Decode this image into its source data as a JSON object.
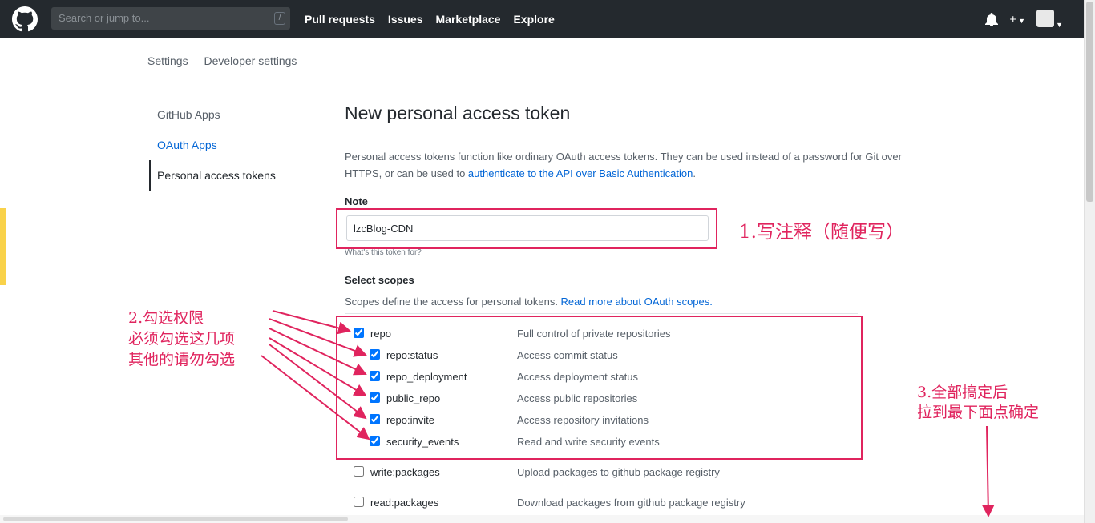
{
  "header": {
    "search_placeholder": "Search or jump to...",
    "search_shortcut": "/",
    "nav": [
      "Pull requests",
      "Issues",
      "Marketplace",
      "Explore"
    ],
    "plus_label": "+"
  },
  "breadcrumb": [
    "Settings",
    "Developer settings"
  ],
  "sidebar": {
    "items": [
      {
        "label": "GitHub Apps"
      },
      {
        "label": "OAuth Apps"
      },
      {
        "label": "Personal access tokens"
      }
    ]
  },
  "main": {
    "title": "New personal access token",
    "desc_line1": "Personal access tokens function like ordinary OAuth access tokens. They can be used instead of a password for Git over",
    "desc_line2_pre": "HTTPS, or can be used to ",
    "desc_link": "authenticate to the API over Basic Authentication",
    "desc_line2_post": ".",
    "note_label": "Note",
    "note_value": "lzcBlog-CDN",
    "note_help": "What's this token for?",
    "scopes_label": "Select scopes",
    "scopes_desc": "Scopes define the access for personal tokens. ",
    "scopes_link": "Read more about OAuth scopes."
  },
  "scopes": [
    {
      "name": "repo",
      "desc": "Full control of private repositories",
      "checked": true
    },
    {
      "name": "repo:status",
      "desc": "Access commit status",
      "checked": true
    },
    {
      "name": "repo_deployment",
      "desc": "Access deployment status",
      "checked": true
    },
    {
      "name": "public_repo",
      "desc": "Access public repositories",
      "checked": true
    },
    {
      "name": "repo:invite",
      "desc": "Access repository invitations",
      "checked": true
    },
    {
      "name": "security_events",
      "desc": "Read and write security events",
      "checked": true
    },
    {
      "name": "write:packages",
      "desc": "Upload packages to github package registry",
      "checked": false
    },
    {
      "name": "read:packages",
      "desc": "Download packages from github package registry",
      "checked": false
    }
  ],
  "annotations": {
    "step1": "1.写注释（随便写）",
    "step2_line1": "2.勾选权限",
    "step2_line2": "必须勾选这几项",
    "step2_line3": "其他的请勿勾选",
    "step3_line1": "3.全部搞定后",
    "step3_line2": "拉到最下面点确定"
  },
  "colors": {
    "header_bg": "#24292e",
    "link": "#0366d6",
    "annotation": "#e0245e",
    "checkbox": "#0075ff"
  }
}
